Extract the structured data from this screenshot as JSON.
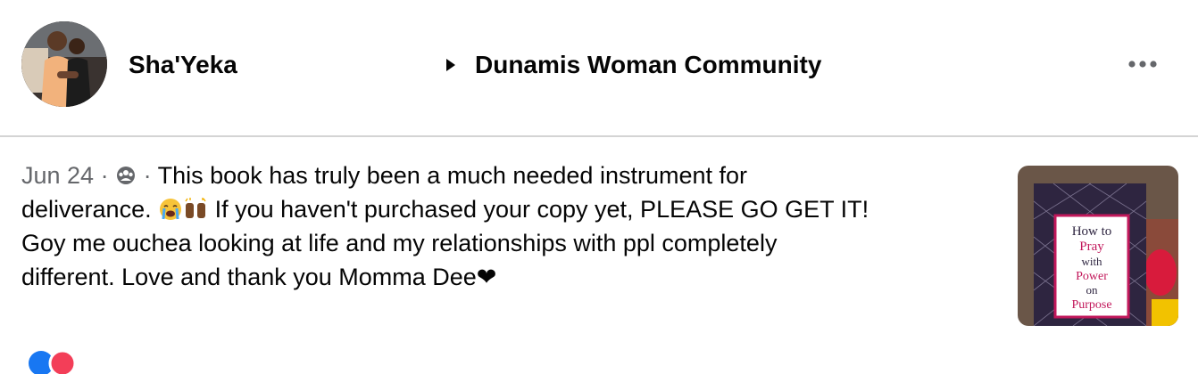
{
  "post": {
    "author": "Sha'Yeka",
    "group": "Dunamis Woman Community",
    "date": "Jun 24",
    "separator": "·",
    "text_line1": "This book has truly been a much needed instrument for",
    "text_line2_a": "deliverance.",
    "text_line2_b": "If you haven't purchased your copy yet, PLEASE GO GET IT!",
    "text_line3": "Goy me ouchea looking at life and my relationships with ppl completely",
    "text_line4": "different. Love and thank you Momma Dee❤",
    "emojis": [
      "loudly-crying-face",
      "raising-hands-dark-skin"
    ],
    "privacy_icon": "group-privacy-icon"
  },
  "book": {
    "title_lines": [
      "How to",
      "Pray",
      "with",
      "Power",
      "on",
      "Purpose"
    ],
    "accent": "#c2185b"
  },
  "colors": {
    "text": "#050505",
    "secondary": "#65676b",
    "like_blue": "#1877f2",
    "love_pink": "#f33e58"
  }
}
